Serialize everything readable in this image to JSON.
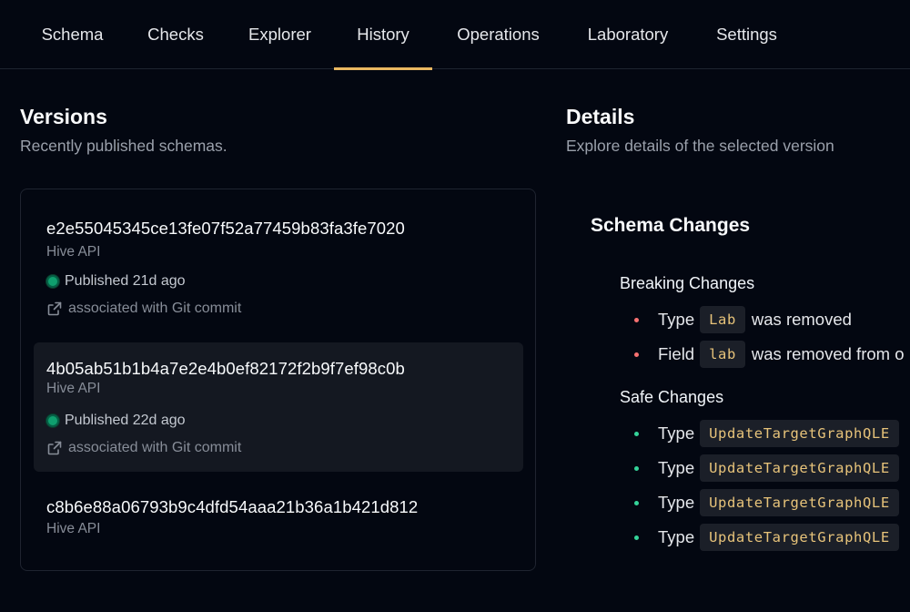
{
  "tabs": [
    {
      "label": "Schema"
    },
    {
      "label": "Checks"
    },
    {
      "label": "Explorer"
    },
    {
      "label": "History"
    },
    {
      "label": "Operations"
    },
    {
      "label": "Laboratory"
    },
    {
      "label": "Settings"
    }
  ],
  "active_tab": "History",
  "versions": {
    "title": "Versions",
    "subtitle": "Recently published schemas.",
    "items": [
      {
        "hash": "e2e55045345ce13fe07f52a77459b83fa3fe7020",
        "project": "Hive API",
        "status": "Published 21d ago",
        "commit": "associated with Git commit"
      },
      {
        "hash": "4b05ab51b1b4a7e2e4b0ef82172f2b9f7ef98c0b",
        "project": "Hive API",
        "status": "Published 22d ago",
        "commit": "associated with Git commit"
      },
      {
        "hash": "c8b6e88a06793b9c4dfd54aaa21b36a1b421d812",
        "project": "Hive API"
      }
    ]
  },
  "details": {
    "title": "Details",
    "subtitle": "Explore details of the selected version",
    "schema_changes_title": "Schema Changes",
    "breaking": {
      "title": "Breaking Changes",
      "items": [
        {
          "prefix": "Type",
          "code": "Lab",
          "suffix": "was removed"
        },
        {
          "prefix": "Field",
          "code": "lab",
          "suffix": "was removed from o"
        }
      ]
    },
    "safe": {
      "title": "Safe Changes",
      "items": [
        {
          "prefix": "Type",
          "code": "UpdateTargetGraphQLE"
        },
        {
          "prefix": "Type",
          "code": "UpdateTargetGraphQLE"
        },
        {
          "prefix": "Type",
          "code": "UpdateTargetGraphQLE"
        },
        {
          "prefix": "Type",
          "code": "UpdateTargetGraphQLE"
        }
      ]
    }
  },
  "colors": {
    "background": "#030711",
    "accent": "#eab861",
    "published": "#0f9f6e",
    "breaking": "#f87171",
    "safe": "#34d399"
  }
}
